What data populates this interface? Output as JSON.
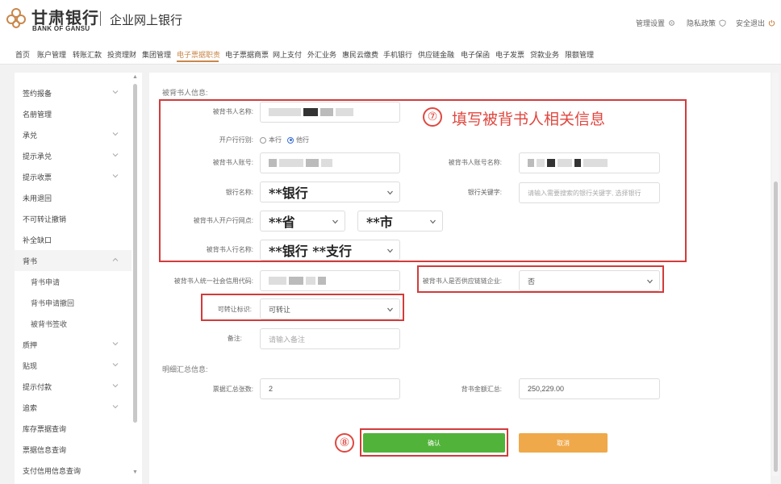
{
  "header": {
    "bank_name_cn": "甘肃银行",
    "bank_name_en": "BANK OF GANSU",
    "portal_title": "企业网上银行",
    "links": [
      {
        "label": "管理设置",
        "icon": "gear-icon"
      },
      {
        "label": "隐私政策",
        "icon": "shield-icon"
      },
      {
        "label": "安全退出",
        "icon": "power-icon"
      }
    ]
  },
  "nav": {
    "items": [
      "首页",
      "账户管理",
      "转账汇款",
      "投资理财",
      "集团管理",
      "电子票据职责",
      "电子票据商票",
      "网上支付",
      "外汇业务",
      "惠民云缴费",
      "手机银行",
      "供应链金融",
      "电子保函",
      "电子发票",
      "贷款业务",
      "限额管理"
    ],
    "active_index": 5
  },
  "sidebar": {
    "items": [
      {
        "label": "签约报备"
      },
      {
        "label": "名册管理"
      },
      {
        "label": "承兑"
      },
      {
        "label": "提示承兑"
      },
      {
        "label": "提示收票"
      },
      {
        "label": "未用退回"
      },
      {
        "label": "不可转让撤销"
      },
      {
        "label": "补全缺口"
      },
      {
        "label": "背书"
      },
      {
        "label": "背书申请"
      },
      {
        "label": "背书申请撤回"
      },
      {
        "label": "被背书签收"
      },
      {
        "label": "质押"
      },
      {
        "label": "贴现"
      },
      {
        "label": "提示付款"
      },
      {
        "label": "追索"
      },
      {
        "label": "库存票据查询"
      },
      {
        "label": "票据信息查询"
      },
      {
        "label": "支付信用信息查询"
      }
    ]
  },
  "form": {
    "section_endorsee": "被背书人信息:",
    "endorsee_name_label": "被背书人名称:",
    "bank_type_label": "开户行行别:",
    "bank_type_options": [
      "本行",
      "他行"
    ],
    "bank_type_selected": "他行",
    "account_no_label": "被背书人账号:",
    "account_name_label": "被背书人账号名称:",
    "bank_name_label": "银行名称:",
    "bank_name_value": "**银行",
    "bank_keyword_label": "银行关键字:",
    "bank_keyword_placeholder": "请输入需要搜索的银行关键字, 选择银行",
    "branch_label": "被背书人开户行网点:",
    "province_value": "**省",
    "city_value": "**市",
    "branch_name_label": "被背书人行名称:",
    "branch_name_value": "**银行 **支行",
    "credit_code_label": "被背书人统一社会信用代码:",
    "supply_chain_label": "被背书人是否供应链链企业:",
    "supply_chain_value": "否",
    "transferable_label": "可转让标识:",
    "transferable_value": "可转让",
    "remark_label": "备注:",
    "remark_placeholder": "请输入备注",
    "section_summary": "明细汇总信息:",
    "count_label": "票据汇总张数:",
    "count_value": "2",
    "amount_label": "背书金额汇总:",
    "amount_value": "250,229.00",
    "confirm_label": "确认",
    "cancel_label": "取消"
  },
  "annotations": {
    "step7_number": "⑦",
    "step7_text": "填写被背书人相关信息",
    "step8_number": "⑧"
  },
  "colors": {
    "accent": "#c9874a",
    "confirm_green": "#52b33b",
    "cancel_orange": "#efa94a",
    "annotation_red": "#d23b3b"
  }
}
